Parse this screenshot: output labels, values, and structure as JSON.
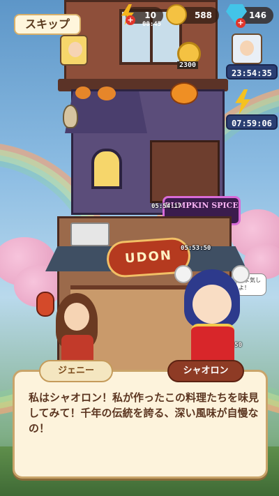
{
  "top_bar": {
    "skip_label": "スキップ",
    "energy": "10",
    "energy_timer": "00:45",
    "coins": "588",
    "gems": "146"
  },
  "timers": {
    "upper_right_1": "23:54:35",
    "upper_right_2": "07:59:06",
    "coin_reward": "2300",
    "halloween_floor": "05:54:17",
    "udon_floor": "05:53:50",
    "right_staff": "05:50"
  },
  "signs": {
    "halloween": "PUMPKIN SPICE",
    "udon": "UDON"
  },
  "speech_bubble": "るよ気しよ！",
  "dialog": {
    "left_name": "ジェニー",
    "right_name": "シャオロン",
    "text": "私はシャオロン！私が作ったこの料理たちを味見してみて！千年の伝統を誇る、深い風味が自慢なの！"
  },
  "colors": {
    "dialog_bg": "#fdf3dc",
    "active_name_bg": "#8e3b25",
    "inactive_name_bg": "#f4e6c0",
    "timer_bg": "#2b3f73"
  }
}
